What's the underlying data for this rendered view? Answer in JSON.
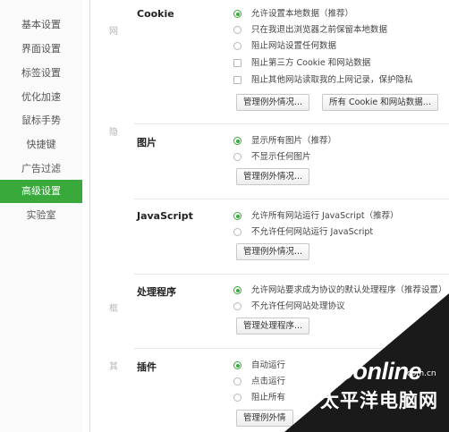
{
  "sidebar": {
    "items": [
      {
        "label": "基本设置"
      },
      {
        "label": "界面设置"
      },
      {
        "label": "标签设置"
      },
      {
        "label": "优化加速"
      },
      {
        "label": "鼠标手势"
      },
      {
        "label": "快捷键"
      },
      {
        "label": "广告过滤"
      },
      {
        "label": "高级设置",
        "active": true
      },
      {
        "label": "实验室"
      }
    ]
  },
  "ghost_labels": [
    "网",
    "隐",
    "框",
    "其"
  ],
  "sections": {
    "cookie": {
      "title": "Cookie",
      "options": [
        {
          "label": "允许设置本地数据（推荐）",
          "type": "radio",
          "checked": true
        },
        {
          "label": "只在我退出浏览器之前保留本地数据",
          "type": "radio",
          "checked": false
        },
        {
          "label": "阻止网站设置任何数据",
          "type": "radio",
          "checked": false
        },
        {
          "label": "阻止第三方 Cookie 和网站数据",
          "type": "checkbox",
          "checked": false
        },
        {
          "label": "阻止其他网站读取我的上网记录，保护隐私",
          "type": "checkbox",
          "checked": false
        }
      ],
      "buttons": [
        "管理例外情况...",
        "所有 Cookie 和网站数据..."
      ]
    },
    "images": {
      "title": "图片",
      "options": [
        {
          "label": "显示所有图片（推荐）",
          "type": "radio",
          "checked": true
        },
        {
          "label": "不显示任何图片",
          "type": "radio",
          "checked": false
        }
      ],
      "buttons": [
        "管理例外情况..."
      ]
    },
    "javascript": {
      "title": "JavaScript",
      "options": [
        {
          "label": "允许所有网站运行 JavaScript（推荐）",
          "type": "radio",
          "checked": true
        },
        {
          "label": "不允许任何网站运行 JavaScript",
          "type": "radio",
          "checked": false
        }
      ],
      "buttons": [
        "管理例外情况..."
      ]
    },
    "handlers": {
      "title": "处理程序",
      "options": [
        {
          "label": "允许网站要求成为协议的默认处理程序（推荐设置）",
          "type": "radio",
          "checked": true
        },
        {
          "label": "不允许任何网站处理协议",
          "type": "radio",
          "checked": false
        }
      ],
      "buttons": [
        "管理处理程序..."
      ]
    },
    "plugins": {
      "title": "插件",
      "options": [
        {
          "label": "自动运行",
          "type": "radio",
          "checked": true
        },
        {
          "label": "点击运行",
          "type": "radio",
          "checked": false
        },
        {
          "label": "阻止所有",
          "type": "radio",
          "checked": false
        }
      ],
      "buttons": [
        "管理例外情"
      ]
    }
  },
  "watermark": {
    "logo": "PConline",
    "domain": ".com.cn",
    "chinese": "太平洋电脑网"
  },
  "colors": {
    "accent": "#39a93c",
    "watermark_bg": "#1a1a1a"
  }
}
